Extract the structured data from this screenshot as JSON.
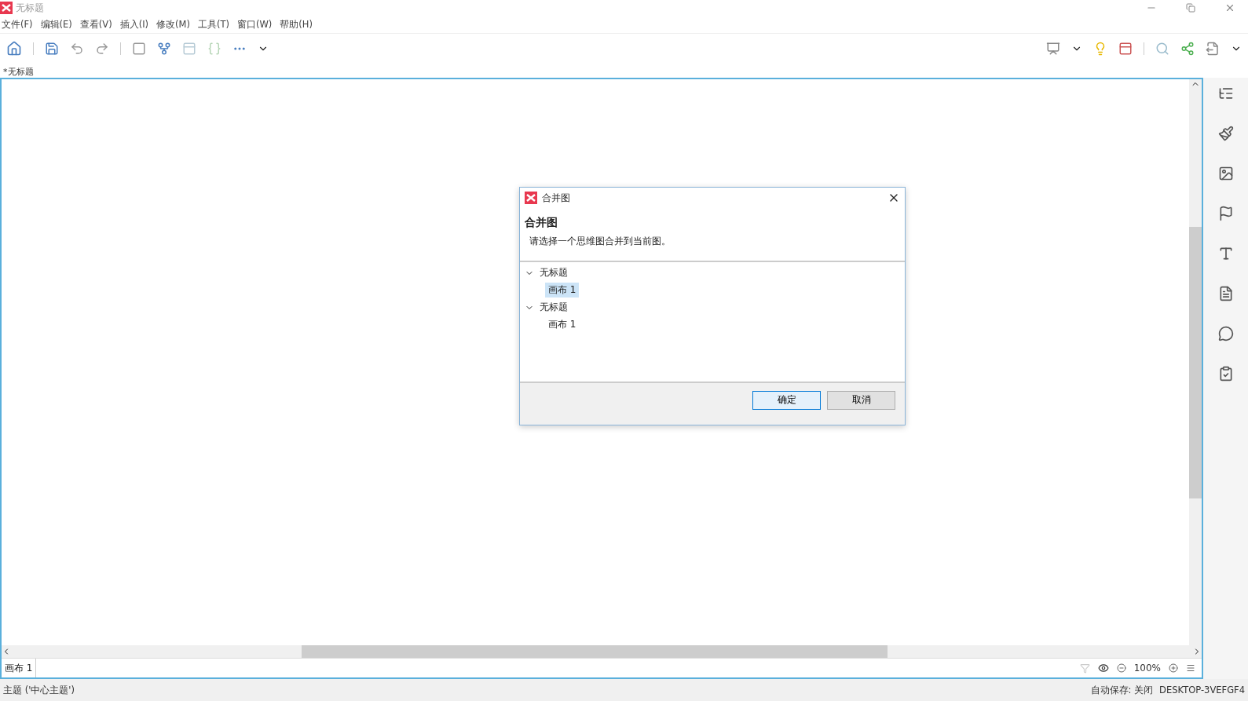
{
  "window": {
    "title": "无标题"
  },
  "menu": [
    "文件(F)",
    "编辑(E)",
    "查看(V)",
    "插入(I)",
    "修改(M)",
    "工具(T)",
    "窗口(W)",
    "帮助(H)"
  ],
  "doc_tabs": [
    {
      "label": "*无标题",
      "selected": true
    }
  ],
  "dialog": {
    "title": "合并图",
    "heading": "合并图",
    "message": "请选择一个思维图合并到当前图。",
    "tree": [
      {
        "label": "无标题",
        "expanded": true,
        "children": [
          {
            "label": "画布 1",
            "selected": true
          }
        ]
      },
      {
        "label": "无标题",
        "expanded": true,
        "children": [
          {
            "label": "画布 1",
            "selected": false
          }
        ]
      }
    ],
    "buttons": [
      {
        "label": "确定",
        "kind": "default"
      },
      {
        "label": "取消",
        "kind": "normal"
      }
    ]
  },
  "sheet_tabs": [
    {
      "label": "画布 1",
      "selected": true
    }
  ],
  "zoom": "100%",
  "status_bar": {
    "selection": "主题 ('中心主题')",
    "autosave": "自动保存: 关闭",
    "computer": "DESKTOP-3VEFGF4"
  }
}
